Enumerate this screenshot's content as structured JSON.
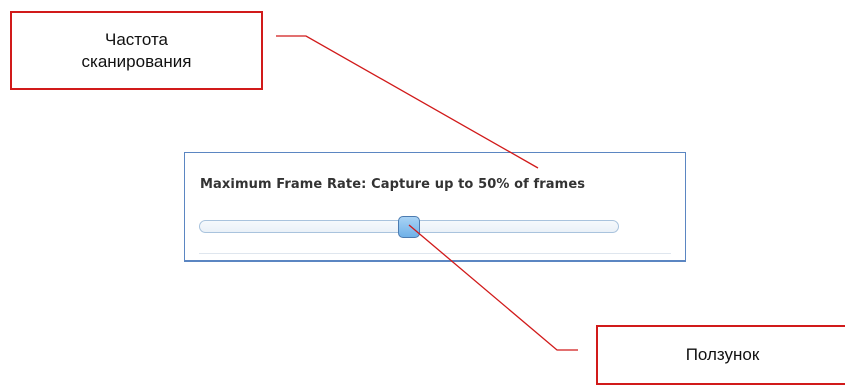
{
  "callouts": {
    "frame_rate": "Частота сканирования",
    "slider": "Ползунок"
  },
  "frame_rate_panel": {
    "label": "Maximum Frame Rate: Capture up to 50% of frames",
    "slider_value_percent": 50
  },
  "colors": {
    "callout_border": "#d11a1a",
    "panel_border": "#5b86c2",
    "thumb_fill": "#6fb1e8"
  }
}
